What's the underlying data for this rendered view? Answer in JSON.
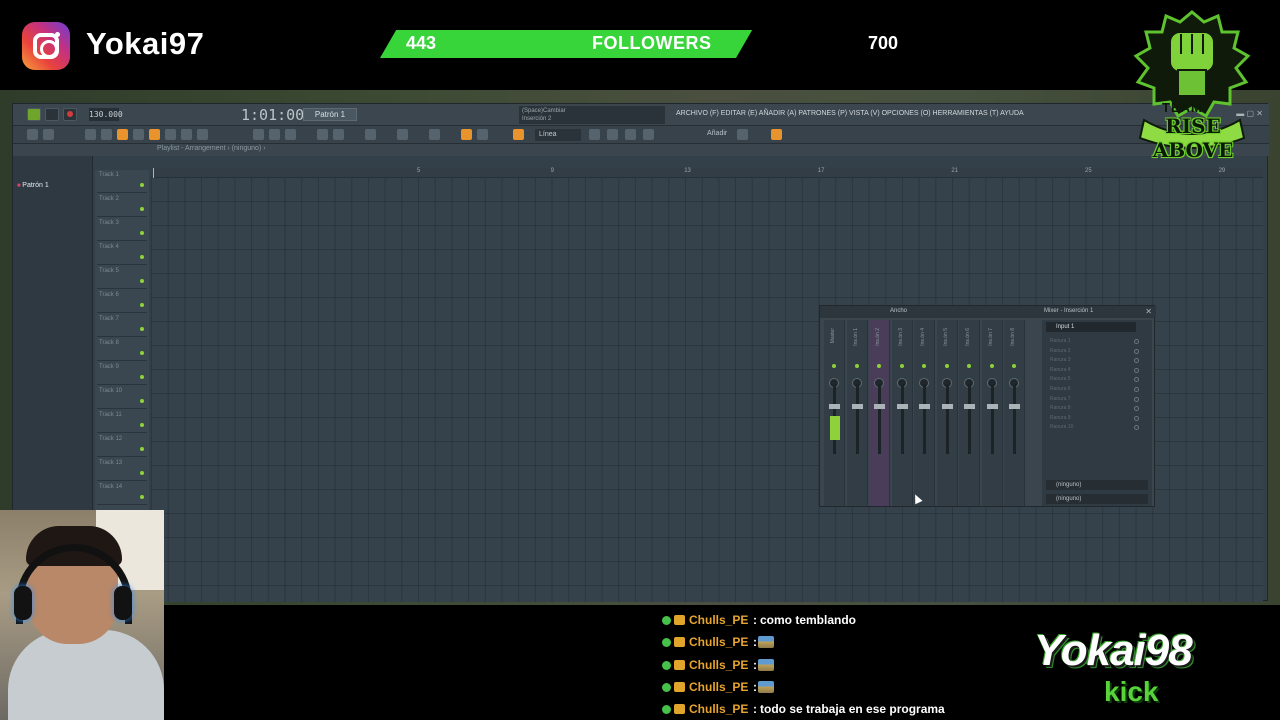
{
  "overlay": {
    "channel_name": "Yokai97",
    "followers": {
      "current": "443",
      "label": "FOLLOWERS",
      "goal": "700"
    },
    "team_logo": {
      "top_word": "TEAM",
      "main_words": "RISE ABOVE"
    },
    "kick_logo": {
      "name": "Yokai98",
      "platform": "kick"
    }
  },
  "daw": {
    "bpm": "130.000",
    "time": "1:01:00",
    "pattern": "Patrón 1",
    "hint_line1": "(Space)Cambiar",
    "hint_line2": "Inserción 2",
    "menu": "ARCHIVO (F) EDITAR (E) AÑADIR (A) PATRONES (P) VISTA (V) OPCIONES (O) HERRAMIENTAS (T) AYUDA",
    "snap": "Línea",
    "add_label": "Añadir",
    "playlist_title": "Playlist - Arrangement › (ninguno) ›",
    "pattern_item": "Patrón 1",
    "tracks": [
      "Track 1",
      "Track 2",
      "Track 3",
      "Track 4",
      "Track 5",
      "Track 6",
      "Track 7",
      "Track 8",
      "Track 9",
      "Track 10",
      "Track 11",
      "Track 12",
      "Track 13",
      "Track 14"
    ],
    "bars": [
      "5",
      "9",
      "13",
      "17",
      "21",
      "25",
      "29"
    ],
    "mixer": {
      "view": "Ancho",
      "title": "Mixer - Inserción 1",
      "strips": [
        "Master",
        "Ins.ón 1",
        "Ins.ón 2",
        "Ins.ón 3",
        "Ins.ón 4",
        "Ins.ón 5",
        "Ins.ón 6",
        "Ins.ón 7",
        "Ins.ón 8"
      ],
      "input": "Input 1",
      "slots": [
        "Ranura 1",
        "Ranura 2",
        "Ranura 3",
        "Ranura 4",
        "Ranura 5",
        "Ranura 6",
        "Ranura 7",
        "Ranura 8",
        "Ranura 9",
        "Ranura 10"
      ],
      "route_a": "(ninguno)",
      "route_b": "(ninguno)"
    }
  },
  "chat": [
    {
      "user": "Chulls_PE",
      "message": "como temblando",
      "emote": false
    },
    {
      "user": "Chulls_PE",
      "message": "",
      "emote": true
    },
    {
      "user": "Chulls_PE",
      "message": "",
      "emote": true
    },
    {
      "user": "Chulls_PE",
      "message": "",
      "emote": true
    },
    {
      "user": "Chulls_PE",
      "message": "todo se trabaja en ese programa",
      "emote": false
    }
  ],
  "colors": {
    "accent_green": "#37d43a",
    "chat_user": "#e7a42e",
    "fl_orange": "#e8932c"
  },
  "icons": [
    "instagram-icon",
    "play-icon",
    "stop-icon",
    "record-icon",
    "mouse-cursor-icon",
    "verified-check-icon",
    "crown-badge-icon",
    "emote-icon"
  ]
}
